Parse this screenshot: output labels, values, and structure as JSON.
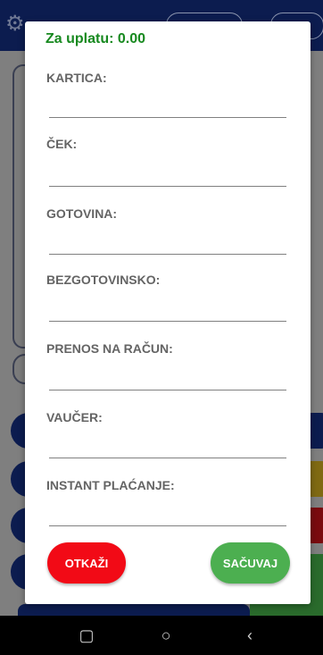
{
  "dialog": {
    "title": "Za uplatu: 0.00",
    "fields": [
      {
        "label": "KARTICA:",
        "value": ""
      },
      {
        "label": "ČEK:",
        "value": ""
      },
      {
        "label": "GOTOVINA:",
        "value": ""
      },
      {
        "label": "BEZGOTOVINSKO:",
        "value": ""
      },
      {
        "label": "PRENOS NA RAČUN:",
        "value": ""
      },
      {
        "label": "VAUČER:",
        "value": ""
      },
      {
        "label": "INSTANT PLAĆANJE:",
        "value": ""
      }
    ],
    "cancel_label": "OTKAŽI",
    "save_label": "SAČUVAJ"
  },
  "colors": {
    "title": "#17891f",
    "cancel": "#f20a16",
    "save": "#4caf50"
  },
  "icons": {
    "settings": "gear-icon",
    "nav_recent": "square-icon",
    "nav_home": "circle-icon",
    "nav_back": "chevron-left-icon"
  }
}
